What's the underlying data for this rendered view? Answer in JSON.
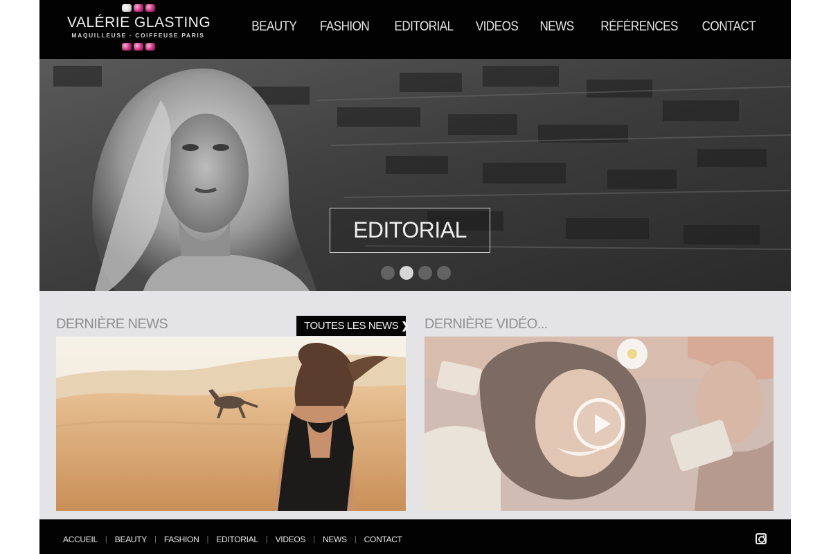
{
  "brand": {
    "name": "VALÉRIE GLASTING",
    "tagline": "MAQUILLEUSE · COIFFEUSE PARIS"
  },
  "nav": {
    "items": [
      "BEAUTY",
      "FASHION",
      "EDITORIAL",
      "VIDEOS",
      "NEWS",
      "RÉFÉRENCES",
      "CONTACT"
    ]
  },
  "hero": {
    "label": "EDITORIAL",
    "slide_count": 4,
    "active_slide": 2
  },
  "news": {
    "title": "DERNIÈRE NEWS",
    "all_button": "TOUTES LES NEWS"
  },
  "video": {
    "title": "DERNIÈRE VIDÉO..."
  },
  "footer": {
    "items": [
      "ACCUEIL",
      "BEAUTY",
      "FASHION",
      "EDITORIAL",
      "VIDEOS",
      "NEWS",
      "CONTACT"
    ]
  },
  "icons": {
    "all_news_arrow": "chevron-right-icon",
    "social": "instagram-icon",
    "video_play": "play-icon"
  },
  "colors": {
    "header_bg": "#020202",
    "content_bg": "#e4e4e6",
    "logo_accent": "#c7317f"
  }
}
